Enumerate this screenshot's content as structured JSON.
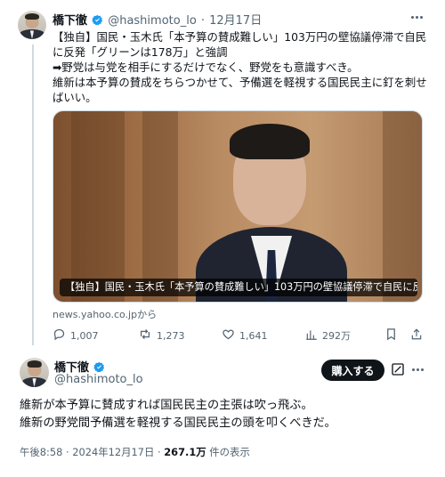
{
  "post": {
    "author": {
      "name": "橋下徹",
      "handle": "@hashimoto_lo",
      "date": "12月17日"
    },
    "lines": [
      "【独自】国民・玉木氏「本予算の賛成難しい」103万円の壁協議停滞で自民",
      "に反発「グリーンは178万」と強調",
      "➡野党は与党を相手にするだけでなく、野党をも意識すべき。",
      "維新は本予算の賛成をちらつかせて、予備選を軽視する国民民主に釘を刺せ",
      "ばいい。"
    ],
    "media": {
      "caption": "【独自】国民・玉木氏「本予算の賛成難しい」103万円の壁協議停滞で自民に反...",
      "source": "news.yahoo.co.jpから"
    },
    "stats": {
      "replies": "1,007",
      "reposts": "1,273",
      "likes": "1,641",
      "views": "292万"
    }
  },
  "reply": {
    "author": {
      "name": "橋下徹",
      "handle": "@hashimoto_lo"
    },
    "subscribe_label": "購入する",
    "lines": [
      "維新が本予算に賛成すれば国民民主の主張は吹っ飛ぶ。",
      "維新の野党間予備選を軽視する国民民主の頭を叩くべきだ。"
    ],
    "meta": {
      "time_date": "午後8:58 · 2024年12月17日 · ",
      "views": "267.1万",
      "views_suffix": " 件の表示"
    }
  },
  "colors": {
    "text": "#0f1419",
    "secondary": "#536471",
    "verified": "#1d9bf0",
    "border": "#cfd9de"
  }
}
